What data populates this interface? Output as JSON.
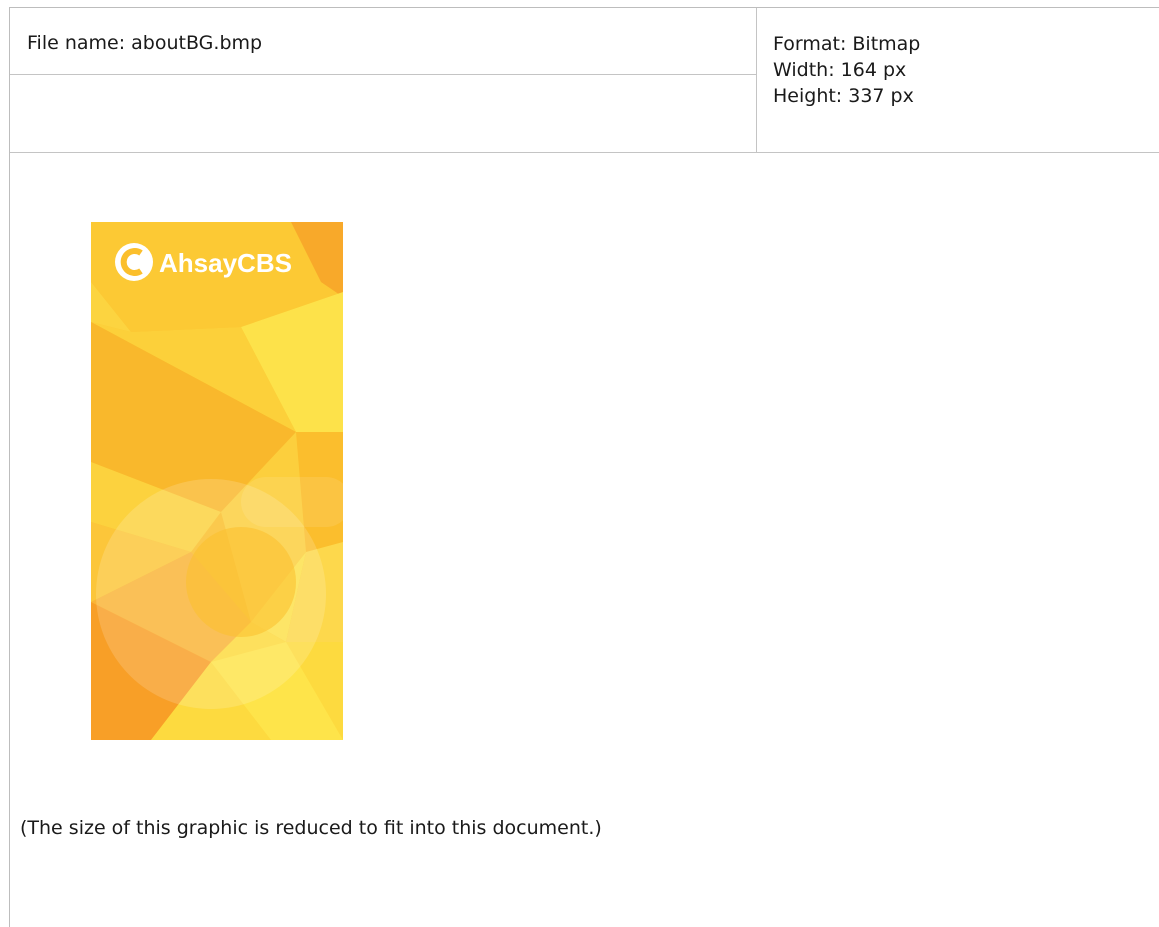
{
  "file": {
    "name_line": "File name: aboutBG.bmp",
    "format_line": "Format: Bitmap",
    "width_line": "Width: 164 px",
    "height_line": "Height: 337 px"
  },
  "image": {
    "logo_text": "AhsayCBS",
    "colors": {
      "base": "#fbbf2c",
      "light": "#fde24a",
      "deep": "#f9a728"
    }
  },
  "caption": "(The size of this graphic is reduced to fit into this document.)"
}
